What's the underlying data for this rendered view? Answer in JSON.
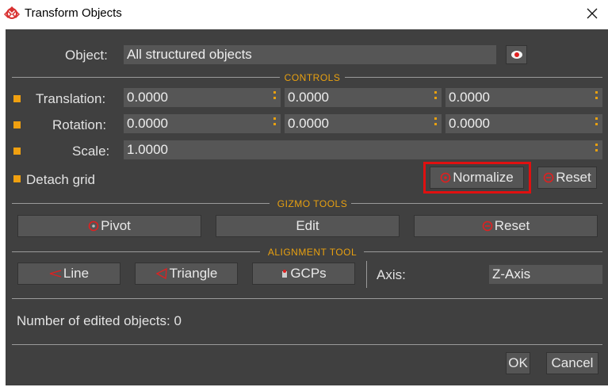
{
  "window": {
    "title": "Transform Objects"
  },
  "object": {
    "label": "Object:",
    "value": "All structured objects"
  },
  "controls": {
    "title": "CONTROLS",
    "translation": {
      "label": "Translation:",
      "x": "0.0000",
      "y": "0.0000",
      "z": "0.0000"
    },
    "rotation": {
      "label": "Rotation:",
      "x": "0.0000",
      "y": "0.0000",
      "z": "0.0000"
    },
    "scale": {
      "label": "Scale:",
      "value": "1.0000"
    },
    "detach_label": "Detach grid",
    "normalize_label": "Normalize",
    "reset_label": "Reset"
  },
  "gizmo": {
    "title": "GIZMO TOOLS",
    "pivot_label": "Pivot",
    "edit_label": "Edit",
    "reset_label": "Reset"
  },
  "alignment": {
    "title": "ALIGNMENT TOOL",
    "line_label": "Line",
    "triangle_label": "Triangle",
    "gcps_label": "GCPs",
    "axis_label": "Axis:",
    "axis_value": "Z-Axis"
  },
  "status": {
    "edited_text": "Number of edited objects: 0"
  },
  "footer": {
    "ok_label": "OK",
    "cancel_label": "Cancel"
  },
  "colors": {
    "panel_bg": "#404040",
    "accent": "#f0a010",
    "highlight": "#e01010"
  }
}
